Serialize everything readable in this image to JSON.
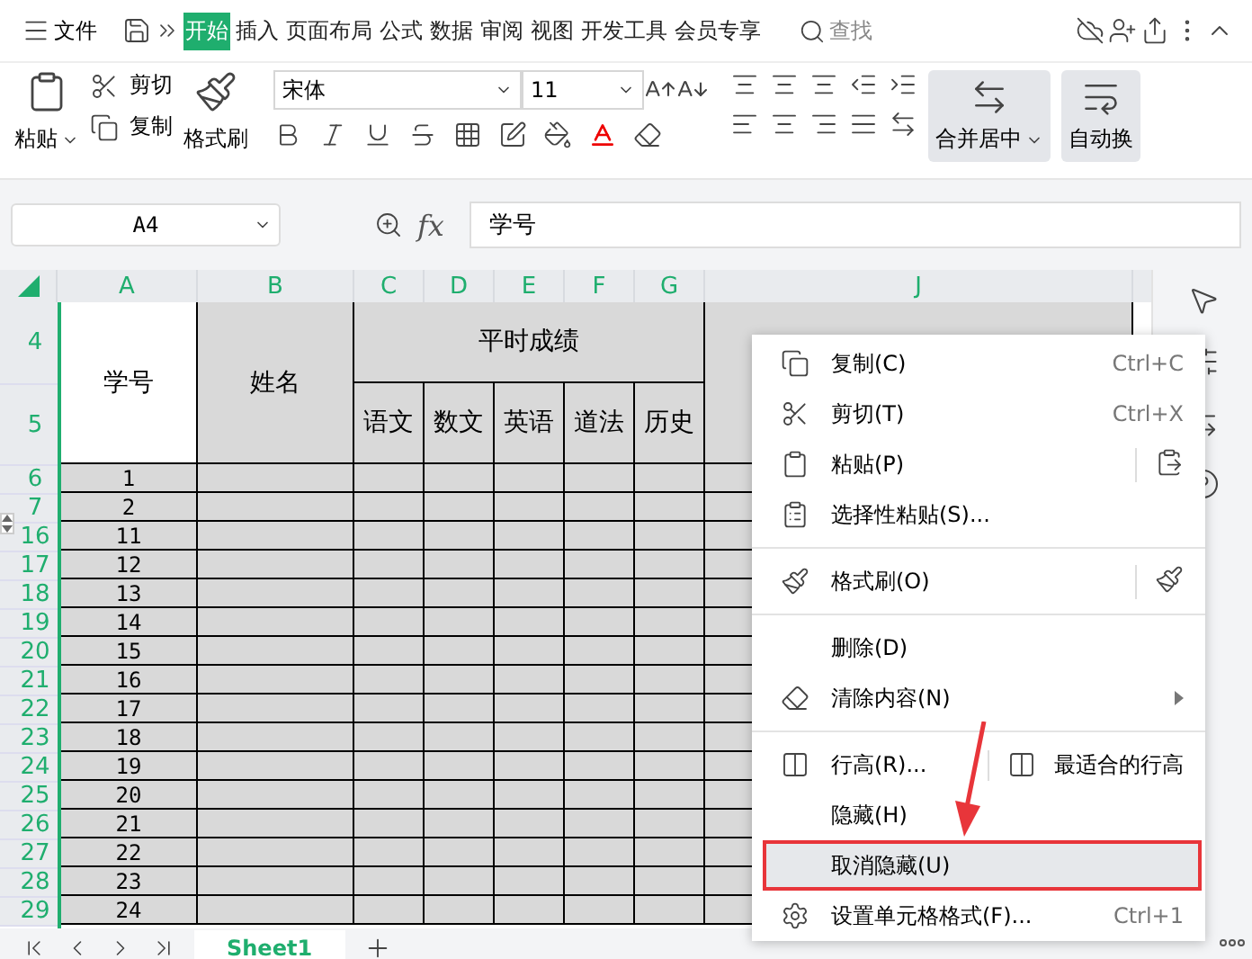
{
  "menubar": {
    "file": "文件",
    "tabs": [
      {
        "label": "开始",
        "selected": true
      },
      {
        "label": "插入",
        "selected": false
      },
      {
        "label": "页面布局",
        "selected": false
      },
      {
        "label": "公式",
        "selected": false
      },
      {
        "label": "数据",
        "selected": false
      },
      {
        "label": "审阅",
        "selected": false
      },
      {
        "label": "视图",
        "selected": false
      },
      {
        "label": "开发工具",
        "selected": false
      },
      {
        "label": "会员专享",
        "selected": false
      }
    ],
    "search": "查找"
  },
  "ribbon": {
    "paste": "粘贴",
    "cut": "剪切",
    "copy": "复制",
    "format_painter": "格式刷",
    "font": "宋体",
    "font_size": "11",
    "merge": "合并居中",
    "wrap": "自动换"
  },
  "formula_bar": {
    "cell": "A4",
    "fx_label": "fx",
    "value": "学号"
  },
  "columns": [
    "A",
    "B",
    "C",
    "D",
    "E",
    "F",
    "G",
    "J"
  ],
  "table": {
    "header_rows": [
      "4",
      "5"
    ],
    "header_number": "学号",
    "header_name": "姓名",
    "group": "平时成绩",
    "subjects": [
      "语文",
      "数文",
      "英语",
      "道法",
      "历史"
    ],
    "rows": [
      {
        "row": "6",
        "number": "1"
      },
      {
        "row": "7",
        "number": "2"
      },
      {
        "row": "16",
        "number": "11"
      },
      {
        "row": "17",
        "number": "12"
      },
      {
        "row": "18",
        "number": "13"
      },
      {
        "row": "19",
        "number": "14"
      },
      {
        "row": "20",
        "number": "15"
      },
      {
        "row": "21",
        "number": "16"
      },
      {
        "row": "22",
        "number": "17"
      },
      {
        "row": "23",
        "number": "18"
      },
      {
        "row": "24",
        "number": "19"
      },
      {
        "row": "25",
        "number": "20"
      },
      {
        "row": "26",
        "number": "21"
      },
      {
        "row": "27",
        "number": "22"
      },
      {
        "row": "28",
        "number": "23"
      },
      {
        "row": "29",
        "number": "24"
      }
    ]
  },
  "sheet_tabs": [
    {
      "label": "Sheet1",
      "selected": true
    }
  ],
  "context_menu": {
    "groups": [
      [
        {
          "label": "复制(C)",
          "shortcut": "Ctrl+C",
          "submenu": false,
          "highlighted": false
        },
        {
          "label": "剪切(T)",
          "shortcut": "Ctrl+X",
          "submenu": false,
          "highlighted": false
        },
        {
          "label": "粘贴(P)",
          "submenu": false,
          "highlighted": false
        },
        {
          "label": "选择性粘贴(S)...",
          "submenu": false,
          "highlighted": false
        }
      ],
      [
        {
          "label": "格式刷(O)",
          "submenu": false,
          "highlighted": false
        }
      ],
      [
        {
          "label": "删除(D)",
          "submenu": false,
          "highlighted": false
        },
        {
          "label": "清除内容(N)",
          "submenu": true,
          "highlighted": false
        }
      ],
      [
        {
          "label": "行高(R)...",
          "side_label": "最适合的行高",
          "submenu": false,
          "highlighted": false
        },
        {
          "label": "隐藏(H)",
          "submenu": false,
          "highlighted": false
        },
        {
          "label": "取消隐藏(U)",
          "submenu": false,
          "highlighted": true
        },
        {
          "label": "设置单元格格式(F)...",
          "shortcut": "Ctrl+1",
          "submenu": false,
          "highlighted": false
        }
      ]
    ]
  }
}
